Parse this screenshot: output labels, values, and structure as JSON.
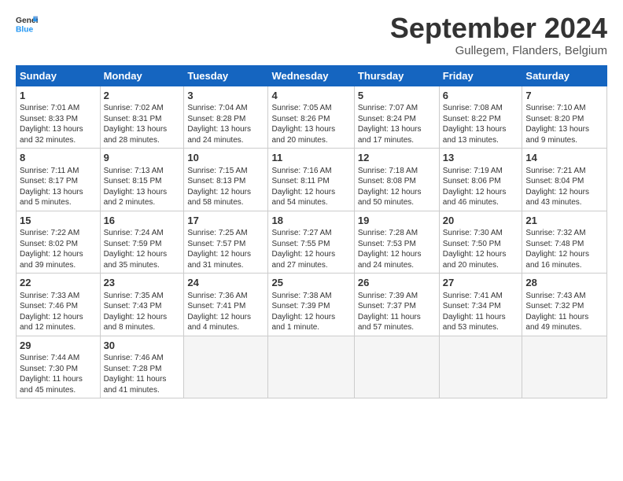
{
  "header": {
    "logo_general": "General",
    "logo_blue": "Blue",
    "month_title": "September 2024",
    "subtitle": "Gullegem, Flanders, Belgium"
  },
  "weekdays": [
    "Sunday",
    "Monday",
    "Tuesday",
    "Wednesday",
    "Thursday",
    "Friday",
    "Saturday"
  ],
  "days": [
    {
      "date": "",
      "detail": ""
    },
    {
      "date": "",
      "detail": ""
    },
    {
      "date": "",
      "detail": ""
    },
    {
      "date": "",
      "detail": ""
    },
    {
      "date": "",
      "detail": ""
    },
    {
      "date": "",
      "detail": ""
    },
    {
      "date": "",
      "detail": ""
    },
    {
      "date": "1",
      "detail": "Sunrise: 7:01 AM\nSunset: 8:33 PM\nDaylight: 13 hours\nand 32 minutes."
    },
    {
      "date": "2",
      "detail": "Sunrise: 7:02 AM\nSunset: 8:31 PM\nDaylight: 13 hours\nand 28 minutes."
    },
    {
      "date": "3",
      "detail": "Sunrise: 7:04 AM\nSunset: 8:28 PM\nDaylight: 13 hours\nand 24 minutes."
    },
    {
      "date": "4",
      "detail": "Sunrise: 7:05 AM\nSunset: 8:26 PM\nDaylight: 13 hours\nand 20 minutes."
    },
    {
      "date": "5",
      "detail": "Sunrise: 7:07 AM\nSunset: 8:24 PM\nDaylight: 13 hours\nand 17 minutes."
    },
    {
      "date": "6",
      "detail": "Sunrise: 7:08 AM\nSunset: 8:22 PM\nDaylight: 13 hours\nand 13 minutes."
    },
    {
      "date": "7",
      "detail": "Sunrise: 7:10 AM\nSunset: 8:20 PM\nDaylight: 13 hours\nand 9 minutes."
    },
    {
      "date": "8",
      "detail": "Sunrise: 7:11 AM\nSunset: 8:17 PM\nDaylight: 13 hours\nand 5 minutes."
    },
    {
      "date": "9",
      "detail": "Sunrise: 7:13 AM\nSunset: 8:15 PM\nDaylight: 13 hours\nand 2 minutes."
    },
    {
      "date": "10",
      "detail": "Sunrise: 7:15 AM\nSunset: 8:13 PM\nDaylight: 12 hours\nand 58 minutes."
    },
    {
      "date": "11",
      "detail": "Sunrise: 7:16 AM\nSunset: 8:11 PM\nDaylight: 12 hours\nand 54 minutes."
    },
    {
      "date": "12",
      "detail": "Sunrise: 7:18 AM\nSunset: 8:08 PM\nDaylight: 12 hours\nand 50 minutes."
    },
    {
      "date": "13",
      "detail": "Sunrise: 7:19 AM\nSunset: 8:06 PM\nDaylight: 12 hours\nand 46 minutes."
    },
    {
      "date": "14",
      "detail": "Sunrise: 7:21 AM\nSunset: 8:04 PM\nDaylight: 12 hours\nand 43 minutes."
    },
    {
      "date": "15",
      "detail": "Sunrise: 7:22 AM\nSunset: 8:02 PM\nDaylight: 12 hours\nand 39 minutes."
    },
    {
      "date": "16",
      "detail": "Sunrise: 7:24 AM\nSunset: 7:59 PM\nDaylight: 12 hours\nand 35 minutes."
    },
    {
      "date": "17",
      "detail": "Sunrise: 7:25 AM\nSunset: 7:57 PM\nDaylight: 12 hours\nand 31 minutes."
    },
    {
      "date": "18",
      "detail": "Sunrise: 7:27 AM\nSunset: 7:55 PM\nDaylight: 12 hours\nand 27 minutes."
    },
    {
      "date": "19",
      "detail": "Sunrise: 7:28 AM\nSunset: 7:53 PM\nDaylight: 12 hours\nand 24 minutes."
    },
    {
      "date": "20",
      "detail": "Sunrise: 7:30 AM\nSunset: 7:50 PM\nDaylight: 12 hours\nand 20 minutes."
    },
    {
      "date": "21",
      "detail": "Sunrise: 7:32 AM\nSunset: 7:48 PM\nDaylight: 12 hours\nand 16 minutes."
    },
    {
      "date": "22",
      "detail": "Sunrise: 7:33 AM\nSunset: 7:46 PM\nDaylight: 12 hours\nand 12 minutes."
    },
    {
      "date": "23",
      "detail": "Sunrise: 7:35 AM\nSunset: 7:43 PM\nDaylight: 12 hours\nand 8 minutes."
    },
    {
      "date": "24",
      "detail": "Sunrise: 7:36 AM\nSunset: 7:41 PM\nDaylight: 12 hours\nand 4 minutes."
    },
    {
      "date": "25",
      "detail": "Sunrise: 7:38 AM\nSunset: 7:39 PM\nDaylight: 12 hours\nand 1 minute."
    },
    {
      "date": "26",
      "detail": "Sunrise: 7:39 AM\nSunset: 7:37 PM\nDaylight: 11 hours\nand 57 minutes."
    },
    {
      "date": "27",
      "detail": "Sunrise: 7:41 AM\nSunset: 7:34 PM\nDaylight: 11 hours\nand 53 minutes."
    },
    {
      "date": "28",
      "detail": "Sunrise: 7:43 AM\nSunset: 7:32 PM\nDaylight: 11 hours\nand 49 minutes."
    },
    {
      "date": "29",
      "detail": "Sunrise: 7:44 AM\nSunset: 7:30 PM\nDaylight: 11 hours\nand 45 minutes."
    },
    {
      "date": "30",
      "detail": "Sunrise: 7:46 AM\nSunset: 7:28 PM\nDaylight: 11 hours\nand 41 minutes."
    }
  ]
}
